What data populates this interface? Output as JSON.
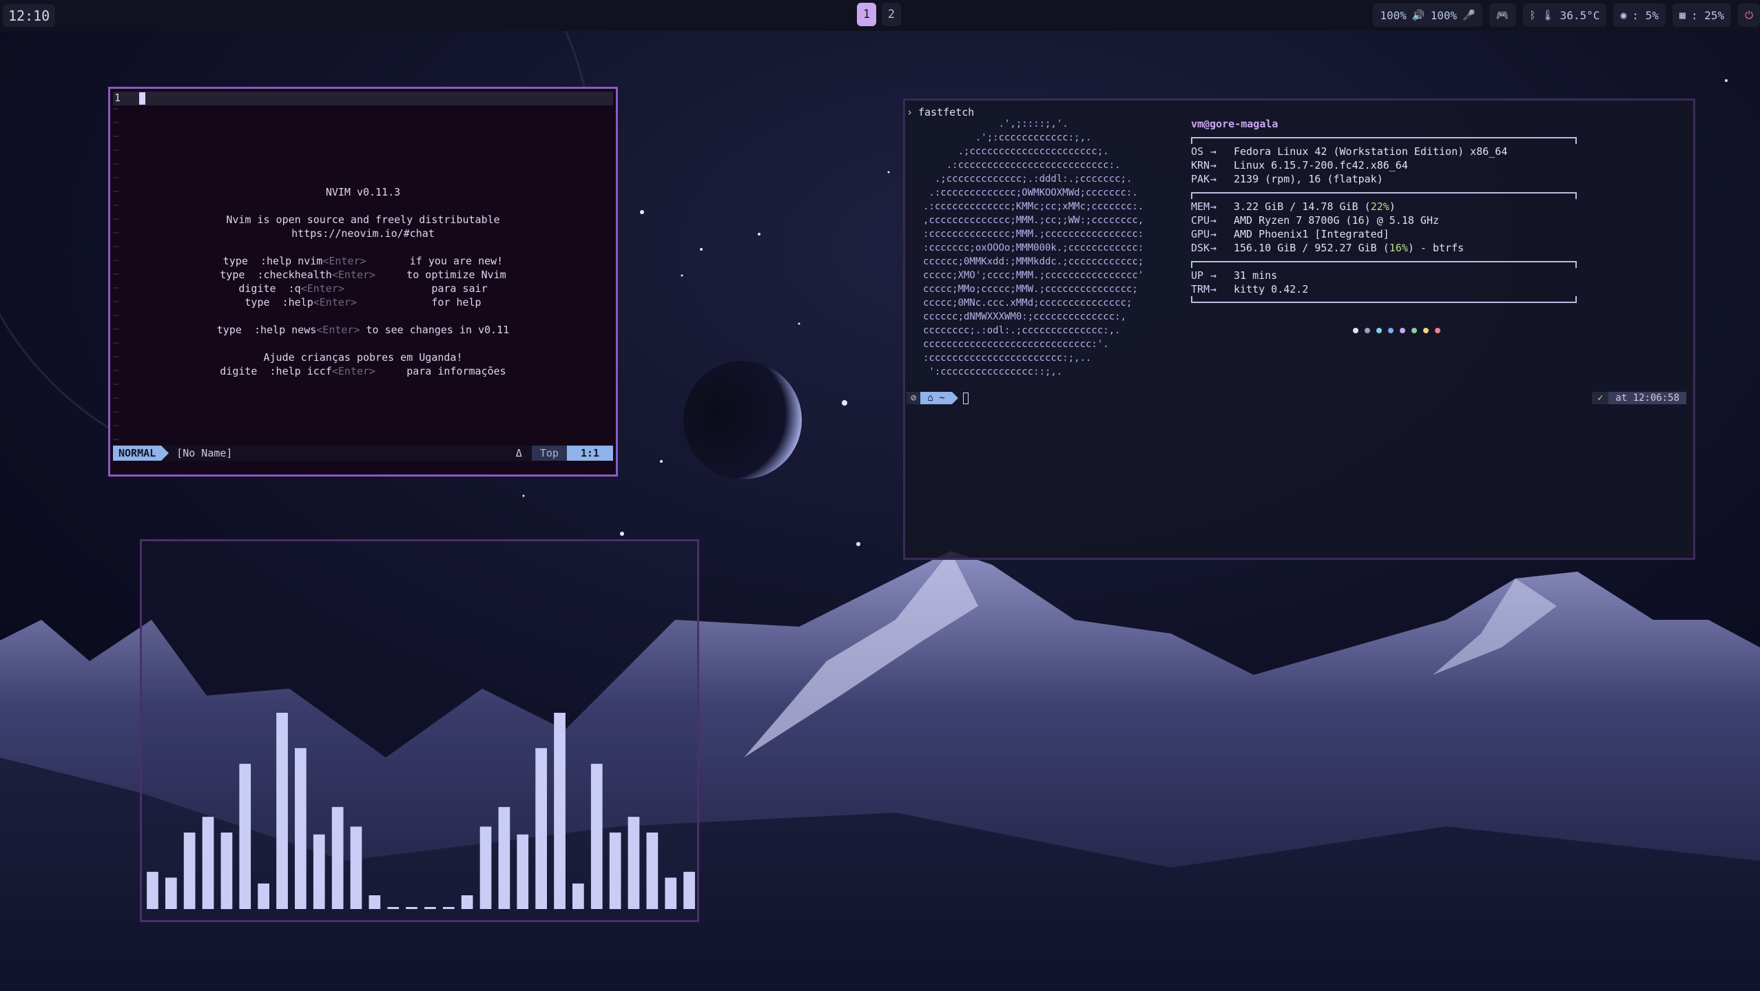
{
  "topbar": {
    "clock": "12:10",
    "workspaces": [
      "1",
      "2"
    ],
    "active_workspace": "1",
    "audio_label": "100%",
    "mic_label": "100%",
    "temperature": "36.5°C",
    "cpu_label": ": 5%",
    "memory_label": ": 25%",
    "icons": [
      "volume-icon",
      "microphone-icon",
      "gamepad-icon",
      "bluetooth-icon",
      "thermometer-icon",
      "cpu-icon",
      "memory-icon",
      "power-icon"
    ]
  },
  "nvim": {
    "line_number": "1",
    "intro_lines": [
      "NVIM v0.11.3",
      "",
      "Nvim is open source and freely distributable",
      "https://neovim.io/#chat",
      "",
      "type  :help nvim<Enter>       if you are new!",
      "type  :checkhealth<Enter>     to optimize Nvim",
      "digite  :q<Enter>              para sair",
      "type  :help<Enter>            for help",
      "",
      "type  :help news<Enter> to see changes in v0.11",
      "",
      "Ajude crianças pobres em Uganda!",
      "digite  :help iccf<Enter>     para informações"
    ],
    "status": {
      "mode": "NORMAL",
      "file": "[No Name]",
      "delta": "Δ",
      "position_word": "Top",
      "cursor_pos": "1:1"
    }
  },
  "terminal": {
    "command": "fastfetch",
    "ascii_logo": [
      "             .',;::::;,'.",
      "         .';:cccccccccccc:;,.",
      "      .;cccccccccccccccccccccc;.",
      "    .:cccccccccccccccccccccccccc:.",
      "  .;ccccccccccccc;.:dddl:.;ccccccc;.",
      " .:ccccccccccccc;OWMKOOXMWd;ccccccc:.",
      ".:ccccccccccccc;KMMc;cc;xMMc;ccccccc:.",
      ",cccccccccccccc;MMM.;cc;;WW:;cccccccc,",
      ":cccccccccccccc;MMM.;cccccccccccccccc:",
      ":ccccccc;oxOOOo;MMM000k.;cccccccccccc:",
      "cccccc;0MMKxdd:;MMMkddc.;cccccccccccc;",
      "ccccc;XMO';cccc;MMM.;cccccccccccccccc'",
      "ccccc;MMo;ccccc;MMW.;ccccccccccccccc;",
      "ccccc;0MNc.ccc.xMMd;ccccccccccccccc;",
      "cccccc;dNMWXXXWM0:;cccccccccccccc:,",
      "cccccccc;.:odl:.;cccccccccccccc:,.",
      "ccccccccccccccccccccccccccccc:'.",
      ":ccccccccccccccccccccccc:;,..",
      " ':cccccccccccccccc::;,."
    ],
    "userhost": "vm@gore-magala",
    "groups": [
      [
        {
          "key": "OS",
          "value": "Fedora Linux 42 (Workstation Edition) x86_64"
        },
        {
          "key": "KRN",
          "value": "Linux 6.15.7-200.fc42.x86_64"
        },
        {
          "key": "PAK",
          "value": "2139 (rpm), 16 (flatpak)"
        }
      ],
      [
        {
          "key": "MEM",
          "value": "3.22 GiB / 14.78 GiB (",
          "hl": "22%",
          "after": ")"
        },
        {
          "key": "CPU",
          "value": "AMD Ryzen 7 8700G (16) @ 5.18 GHz"
        },
        {
          "key": "GPU",
          "value": "AMD Phoenix1 [Integrated]"
        },
        {
          "key": "DSK",
          "value": "156.10 GiB / 952.27 GiB (",
          "hl": "16%",
          "after": ") - btrfs"
        }
      ],
      [
        {
          "key": "UP",
          "value": "31 mins"
        },
        {
          "key": "TRM",
          "value": "kitty 0.42.2"
        }
      ]
    ],
    "palette": [
      "#e4e3f0",
      "#a0a0c0",
      "#7fd4e8",
      "#7fa8f0",
      "#c9a8ef",
      "#8bd0a0",
      "#f2d47a",
      "#f07f8f"
    ],
    "prompt_dir_icon": "home-icon",
    "prompt_status": "✓",
    "prompt_time": "at 12:06:58"
  },
  "visualizer": {
    "bar_heights": [
      0.19,
      0.16,
      0.39,
      0.47,
      0.39,
      0.74,
      0.13,
      1.0,
      0.82,
      0.38,
      0.52,
      0.42,
      0.07,
      0.01,
      0.01,
      0.01,
      0.01,
      0.07,
      0.42,
      0.52,
      0.38,
      0.82,
      1.0,
      0.13,
      0.74,
      0.39,
      0.47,
      0.39,
      0.16,
      0.19
    ],
    "color": "#c9cdf6"
  }
}
